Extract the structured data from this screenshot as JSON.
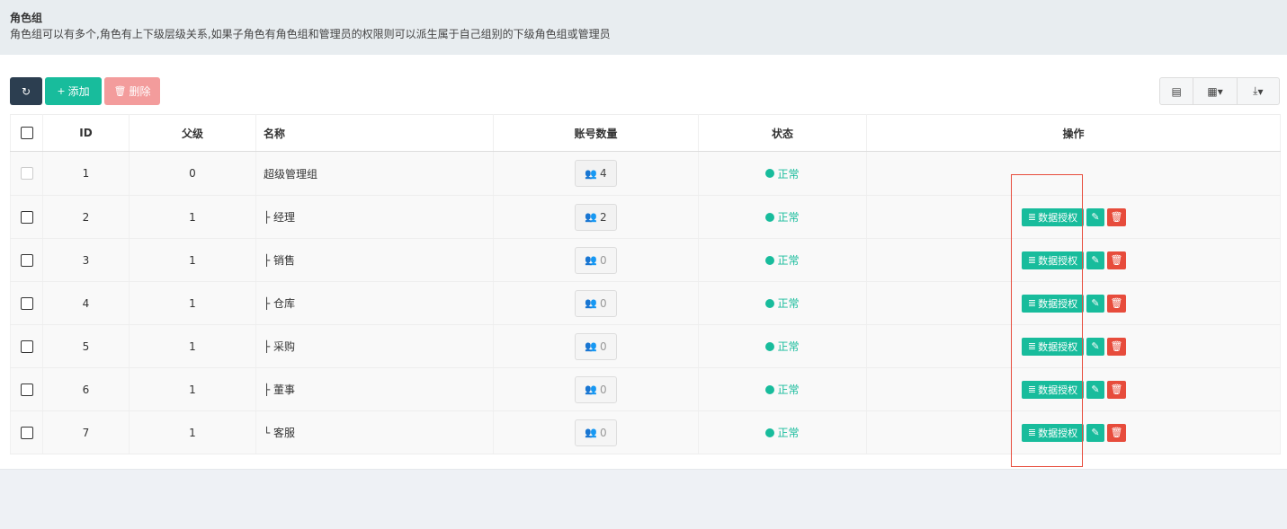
{
  "panel": {
    "title": "角色组",
    "description": "角色组可以有多个,角色有上下级层级关系,如果子角色有角色组和管理员的权限则可以派生属于自己组别的下级角色组或管理员"
  },
  "toolbar": {
    "refresh_icon": "↻",
    "add_label": "添加",
    "add_icon": "+",
    "delete_label": "删除",
    "delete_icon": "🗑",
    "columns_icon": "▦",
    "view_icon": "▤",
    "export_icon": "⤓",
    "caret": "▾"
  },
  "table": {
    "headers": {
      "id": "ID",
      "parent": "父级",
      "name": "名称",
      "accounts": "账号数量",
      "status": "状态",
      "operations": "操作"
    },
    "rows": [
      {
        "id": "1",
        "parent": "0",
        "name": "超级管理组",
        "accounts": "4",
        "status": "正常"
      },
      {
        "id": "2",
        "parent": "1",
        "name": "├ 经理",
        "accounts": "2",
        "status": "正常"
      },
      {
        "id": "3",
        "parent": "1",
        "name": "├ 销售",
        "accounts": "0",
        "status": "正常"
      },
      {
        "id": "4",
        "parent": "1",
        "name": "├ 仓库",
        "accounts": "0",
        "status": "正常"
      },
      {
        "id": "5",
        "parent": "1",
        "name": "├ 采购",
        "accounts": "0",
        "status": "正常"
      },
      {
        "id": "6",
        "parent": "1",
        "name": "├ 董事",
        "accounts": "0",
        "status": "正常"
      },
      {
        "id": "7",
        "parent": "1",
        "name": "└ 客服",
        "accounts": "0",
        "status": "正常"
      }
    ],
    "op_auth_label": "数据授权",
    "op_auth_icon": "≣",
    "op_edit_icon": "✎",
    "op_delete_icon": "🗑",
    "account_icon": "👥"
  },
  "colors": {
    "primary": "#18bc9c",
    "danger": "#e74c3c",
    "dark": "#2c3e50",
    "highlight_border": "#e74c3c"
  }
}
